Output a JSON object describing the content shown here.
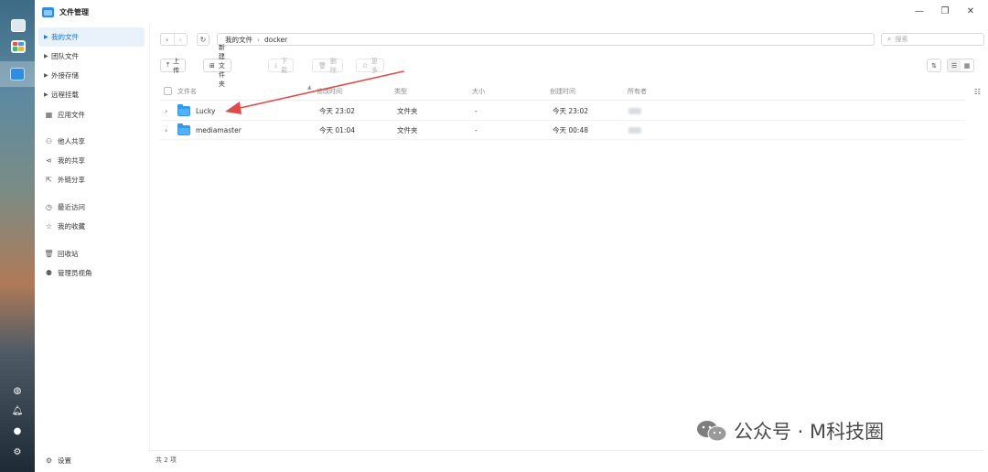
{
  "window": {
    "title": "文件管理"
  },
  "sidebar": {
    "items": [
      {
        "label": "我的文件",
        "icon": "chevron-right-icon",
        "active": true
      },
      {
        "label": "团队文件",
        "icon": "chevron-right-icon"
      },
      {
        "label": "外接存储",
        "icon": "chevron-right-icon"
      },
      {
        "label": "远程挂载",
        "icon": "chevron-right-icon"
      },
      {
        "label": "应用文件",
        "icon": "apps-icon"
      },
      {
        "label": "他人共享",
        "icon": "user-icon"
      },
      {
        "label": "我的共享",
        "icon": "share-icon"
      },
      {
        "label": "外链分享",
        "icon": "external-link-icon"
      },
      {
        "label": "最近访问",
        "icon": "clock-icon"
      },
      {
        "label": "我的收藏",
        "icon": "star-icon"
      },
      {
        "label": "回收站",
        "icon": "trash-icon"
      },
      {
        "label": "管理员视角",
        "icon": "admin-icon"
      }
    ],
    "settings_label": "设置"
  },
  "path": {
    "root": "我的文件",
    "current": "docker"
  },
  "search": {
    "placeholder": "搜索"
  },
  "toolbar": {
    "upload": "上传",
    "new_folder": "新建文件夹",
    "download": "下载",
    "delete": "删除",
    "more": "更多"
  },
  "table": {
    "headers": {
      "name": "文件名",
      "modified": "修改时间",
      "type": "类型",
      "size": "大小",
      "created": "创建时间",
      "owner": "所有者"
    },
    "rows": [
      {
        "name": "Lucky",
        "modified": "今天 23:02",
        "type": "文件夹",
        "size": "-",
        "created": "今天 23:02"
      },
      {
        "name": "mediamaster",
        "modified": "今天 01:04",
        "type": "文件夹",
        "size": "-",
        "created": "今天 00:48"
      }
    ]
  },
  "status": {
    "count": "共 2 项"
  },
  "watermark": {
    "text": "公众号 · M科技圈"
  },
  "colors": {
    "accent": "#1a73d9",
    "folder": "#2e9bf0",
    "annotation_arrow": "#e24a4a"
  }
}
